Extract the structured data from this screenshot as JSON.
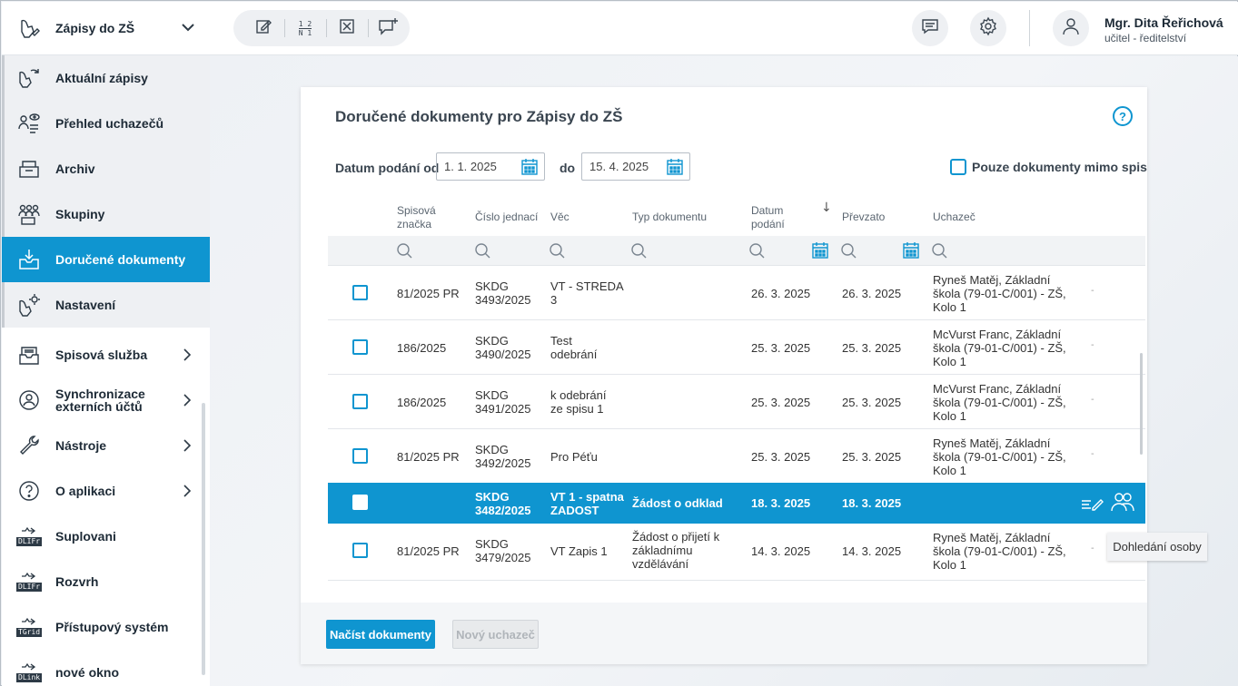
{
  "sidebar": {
    "header": {
      "label": "Zápisy do ZŠ",
      "icon": "hand-pen-icon"
    },
    "sub_items": [
      {
        "label": "Aktuální zápisy",
        "icon": "refresh-hand-icon"
      },
      {
        "label": "Přehled uchazečů",
        "icon": "people-eye-icon"
      },
      {
        "label": "Archiv",
        "icon": "archive-box-icon"
      },
      {
        "label": "Skupiny",
        "icon": "group-icon"
      },
      {
        "label": "Doručené dokumenty",
        "icon": "inbox-download-icon",
        "active": true
      },
      {
        "label": "Nastavení",
        "icon": "hand-gear-icon"
      }
    ],
    "items": [
      {
        "label": "Spisová služba",
        "icon": "file-tray-icon"
      },
      {
        "label": "Synchronizace externích účtů",
        "icon": "user-sync-icon"
      },
      {
        "label": "Nástroje",
        "icon": "wrench-icon"
      },
      {
        "label": "O aplikaci",
        "icon": "question-circle-icon"
      },
      {
        "label": "Suplovani",
        "icon": "module-icon",
        "badge": "DLIFr"
      },
      {
        "label": "Rozvrh",
        "icon": "module-icon",
        "badge": "DLIFr"
      },
      {
        "label": "Přístupový systém",
        "icon": "module-icon",
        "badge": "TGrid"
      },
      {
        "label": "nové okno",
        "icon": "module-icon",
        "badge": "DLink"
      }
    ]
  },
  "topbar": {
    "tools": [
      "edit-icon",
      "numbering-icon",
      "close-box-icon",
      "comment-add-icon"
    ],
    "numbering_top": "1 2",
    "numbering_bottom": "N 1",
    "user_name": "Mgr. Dita Řeřichová",
    "user_role": "učitel - ředitelství"
  },
  "card": {
    "title": "Doručené dokumenty pro Zápisy do ZŠ",
    "help": "?",
    "filter": {
      "from_label": "Datum podání od",
      "from_value": "1. 1. 2025",
      "to_label": "do",
      "to_value": "15. 4. 2025",
      "checkbox_label": "Pouze dokumenty mimo spis"
    },
    "columns": {
      "spisova_1": "Spisová",
      "spisova_2": "značka",
      "cislo": "Číslo jednací",
      "vec": "Věc",
      "typ": "Typ dokumentu",
      "datum_1": "Datum",
      "datum_2": "podání",
      "sort": "↓",
      "prevzato": "Převzato",
      "uchazec": "Uchazeč"
    },
    "rows": [
      {
        "spis": "81/2025 PR",
        "cj1": "SKDG",
        "cj2": "3493/2025",
        "vec1": "VT - STREDA",
        "vec2": "3",
        "typ1": "",
        "typ2": "",
        "typ3": "",
        "datum": "26. 3. 2025",
        "prevzato": "26. 3. 2025",
        "u1": "Ryneš Matěj, Základní",
        "u2": "škola (79-01-C/001) - ZŠ,",
        "u3": "Kolo 1",
        "dash": "-"
      },
      {
        "spis": "186/2025",
        "cj1": "SKDG",
        "cj2": "3490/2025",
        "vec1": "Test",
        "vec2": "odebrání",
        "typ1": "",
        "typ2": "",
        "typ3": "",
        "datum": "25. 3. 2025",
        "prevzato": "25. 3. 2025",
        "u1": "McVurst Franc, Základní",
        "u2": "škola (79-01-C/001) - ZŠ,",
        "u3": "Kolo 1",
        "dash": "-"
      },
      {
        "spis": "186/2025",
        "cj1": "SKDG",
        "cj2": "3491/2025",
        "vec1": "k odebrání",
        "vec2": "ze spisu 1",
        "typ1": "",
        "typ2": "",
        "typ3": "",
        "datum": "25. 3. 2025",
        "prevzato": "25. 3. 2025",
        "u1": "McVurst Franc, Základní",
        "u2": "škola (79-01-C/001) - ZŠ,",
        "u3": "Kolo 1",
        "dash": "-"
      },
      {
        "spis": "81/2025 PR",
        "cj1": "SKDG",
        "cj2": "3492/2025",
        "vec1": "Pro Péťu",
        "vec2": "",
        "typ1": "",
        "typ2": "",
        "typ3": "",
        "datum": "25. 3. 2025",
        "prevzato": "25. 3. 2025",
        "u1": "Ryneš Matěj, Základní",
        "u2": "škola (79-01-C/001) - ZŠ,",
        "u3": "Kolo 1",
        "dash": "-"
      },
      {
        "spis": "",
        "cj1": "SKDG",
        "cj2": "3482/2025",
        "vec1": "VT 1 - spatna",
        "vec2": "ZADOST",
        "typ1": "Žádost o odklad",
        "typ2": "",
        "typ3": "",
        "datum": "18. 3. 2025",
        "prevzato": "18. 3. 2025",
        "u1": "",
        "u2": "",
        "u3": "",
        "dash": "",
        "selected": true
      },
      {
        "spis": "81/2025 PR",
        "cj1": "SKDG",
        "cj2": "3479/2025",
        "vec1": "VT Zapis 1",
        "vec2": "",
        "typ1": "Žádost o přijetí k",
        "typ2": "základnímu",
        "typ3": "vzdělávání",
        "datum": "14. 3. 2025",
        "prevzato": "14. 3. 2025",
        "u1": "Ryneš Matěj, Základní",
        "u2": "škola (79-01-C/001) - ZŠ,",
        "u3": "Kolo 1",
        "dash": "-"
      }
    ],
    "tooltip": "Dohledání osoby",
    "btn_load": "Načíst dokumenty",
    "btn_new": "Nový uchazeč"
  },
  "colors": {
    "accent": "#0f95d0",
    "text_dark": "#1d2a36"
  }
}
